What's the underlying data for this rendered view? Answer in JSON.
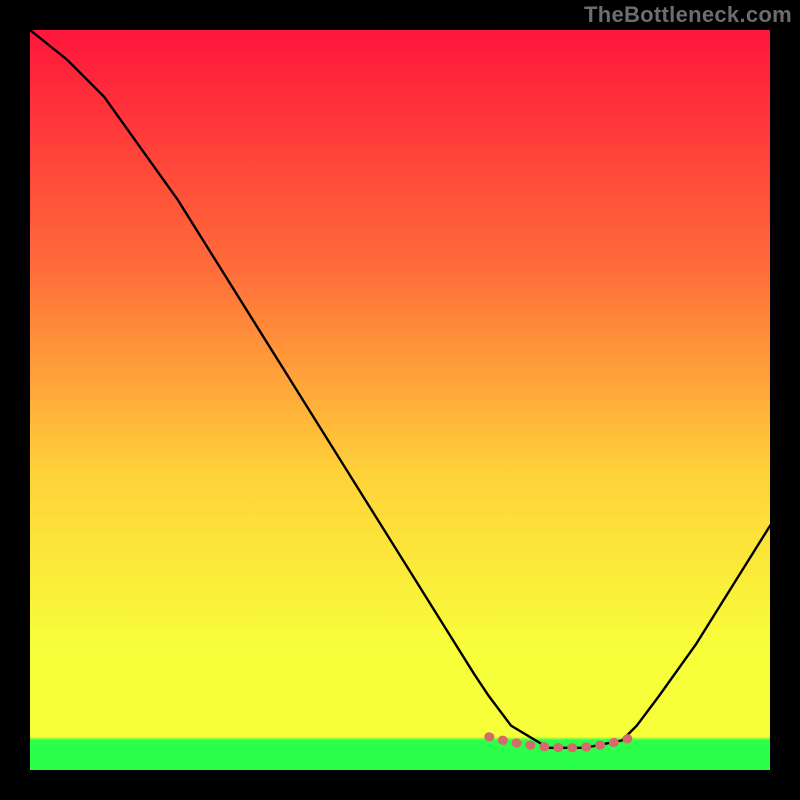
{
  "watermark": "TheBottleneck.com",
  "colors": {
    "bg": "#000000",
    "curve": "#000000",
    "accent": "#d46a6a",
    "gradient_top": "#ff153b",
    "gradient_mid_upper": "#ff6f3a",
    "gradient_mid": "#ffd23a",
    "gradient_mid_lower": "#f7ff3a",
    "gradient_green": "#2bff4a",
    "watermark_color": "#6d6d6d"
  },
  "chart_data": {
    "type": "line",
    "title": "",
    "xlabel": "",
    "ylabel": "",
    "xlim": [
      0,
      100
    ],
    "ylim": [
      0,
      100
    ],
    "grid": false,
    "legend": false,
    "series": [
      {
        "name": "bottleneck-curve",
        "x": [
          0,
          5,
          10,
          15,
          20,
          25,
          30,
          35,
          40,
          45,
          50,
          55,
          60,
          62,
          65,
          70,
          75,
          80,
          82,
          85,
          90,
          95,
          100
        ],
        "y": [
          100,
          96,
          91,
          84,
          77,
          69,
          61,
          53,
          45,
          37,
          29,
          21,
          13,
          10,
          6,
          3,
          3,
          4,
          6,
          10,
          17,
          25,
          33
        ]
      }
    ],
    "annotations": [
      {
        "name": "optimal-zone-dots",
        "x": [
          62,
          64,
          66,
          68,
          70,
          72,
          74,
          76,
          78,
          80,
          82
        ],
        "y": [
          4.5,
          4.0,
          3.6,
          3.3,
          3.1,
          3.0,
          3.0,
          3.2,
          3.5,
          4.0,
          4.6
        ]
      }
    ]
  }
}
